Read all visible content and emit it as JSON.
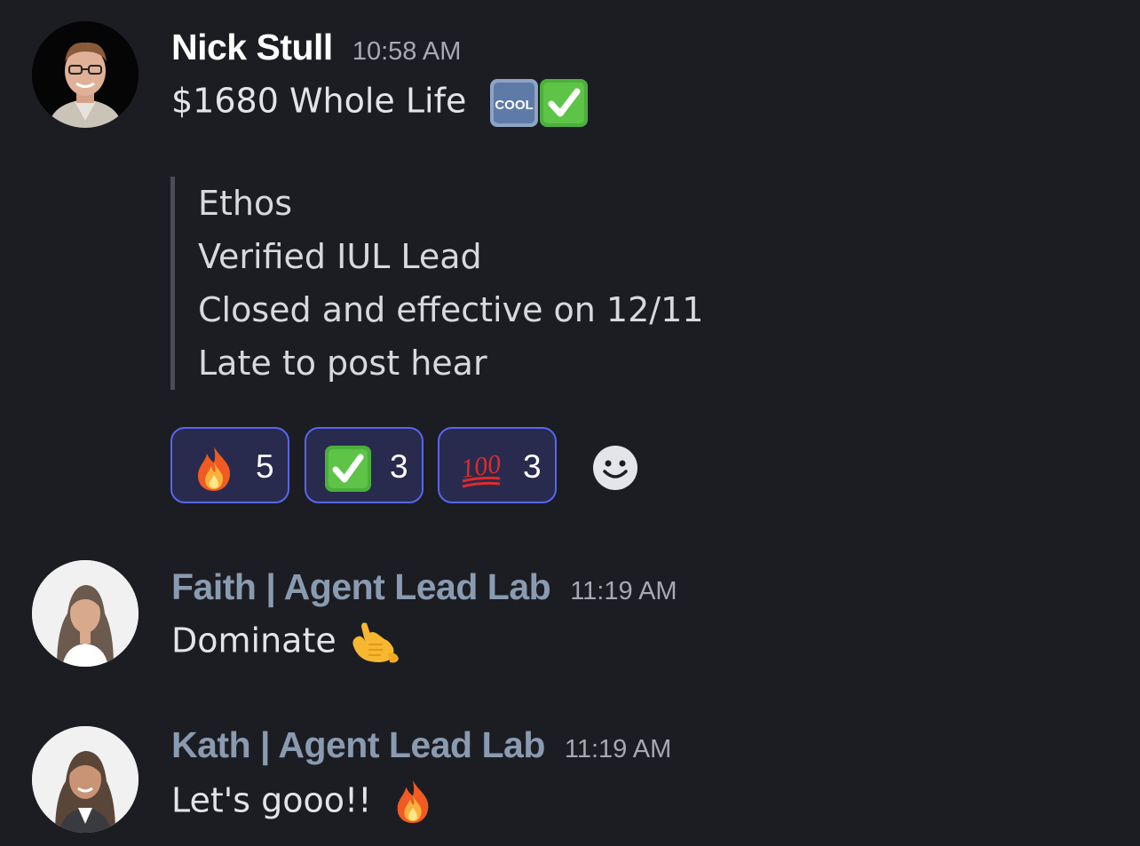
{
  "messages": [
    {
      "author": "Nick Stull",
      "author_color": "#ffffff",
      "time": "10:58 AM",
      "text": "$1680 Whole Life",
      "emojis": [
        "cool-emoji",
        "check-mark-emoji"
      ],
      "cool_label": "COOL",
      "quote_lines": [
        "Ethos",
        "Verified IUL Lead",
        "Closed and effective on 12/11",
        "Late to post hear"
      ],
      "reactions": [
        {
          "emoji": "fire-icon",
          "count": "5"
        },
        {
          "emoji": "check-mark-icon",
          "count": "3"
        },
        {
          "emoji": "hundred-points-icon",
          "count": "3"
        }
      ]
    },
    {
      "author": "Faith | Agent Lead Lab",
      "author_color": "#8a9bb1",
      "time": "11:19 AM",
      "text": "Dominate",
      "emojis": [
        "call-me-hand-emoji"
      ]
    },
    {
      "author": "Kath | Agent Lead Lab",
      "author_color": "#8a9bb1",
      "time": "11:19 AM",
      "text": "Let's gooo!!",
      "emojis": [
        "fire-emoji"
      ]
    }
  ],
  "colors": {
    "background": "#1c1d22",
    "reaction_border": "#5865f2",
    "reaction_bg": "#282b4d"
  }
}
